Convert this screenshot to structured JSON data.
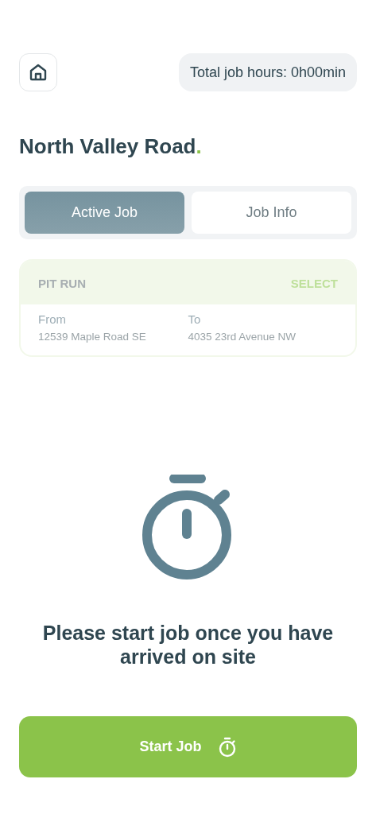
{
  "header": {
    "total_hours": "Total job hours: 0h00min"
  },
  "title": "North Valley Road",
  "title_mark": ".",
  "tabs": [
    {
      "label": "Active Job",
      "selected": true
    },
    {
      "label": "Job Info",
      "selected": false
    }
  ],
  "job_card": {
    "material": "PIT RUN",
    "action": "SELECT",
    "disabled": true,
    "from_label": "From",
    "from": "12539 Maple Road SE",
    "to_label": "To",
    "to": "4035 23rd Avenue NW"
  },
  "message": "Please start job once you have arrived on site",
  "start_button": {
    "label": "Start Job"
  }
}
